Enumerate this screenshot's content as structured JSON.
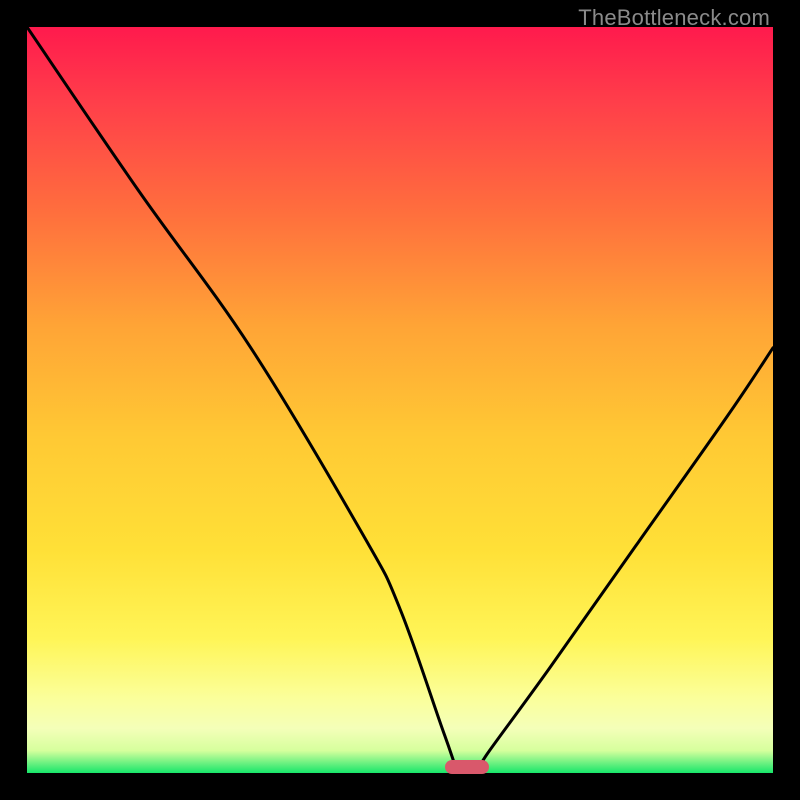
{
  "watermark": "TheBottleneck.com",
  "chart_data": {
    "type": "line",
    "title": "",
    "xlabel": "",
    "ylabel": "",
    "xlim": [
      0,
      100
    ],
    "ylim": [
      0,
      100
    ],
    "grid": false,
    "series": [
      {
        "name": "bottleneck-curve",
        "x": [
          0,
          15,
          30,
          45,
          50,
          56,
          58,
          60,
          62,
          70,
          82,
          94,
          100
        ],
        "values": [
          100,
          78,
          57,
          32,
          22,
          5,
          0,
          0,
          3,
          14,
          31,
          48,
          57
        ]
      }
    ],
    "marker": {
      "x": 59,
      "y": 0.8,
      "color": "#d9586b"
    },
    "background_gradient_stops": [
      {
        "pos": 0,
        "color": "#ff1a4d"
      },
      {
        "pos": 10,
        "color": "#ff3e4a"
      },
      {
        "pos": 25,
        "color": "#ff6f3d"
      },
      {
        "pos": 40,
        "color": "#ffa436"
      },
      {
        "pos": 55,
        "color": "#ffc934"
      },
      {
        "pos": 70,
        "color": "#ffe037"
      },
      {
        "pos": 82,
        "color": "#fff557"
      },
      {
        "pos": 90,
        "color": "#fbff9b"
      },
      {
        "pos": 94,
        "color": "#f4ffb9"
      },
      {
        "pos": 97,
        "color": "#d6ff9d"
      },
      {
        "pos": 100,
        "color": "#17e66a"
      }
    ]
  }
}
